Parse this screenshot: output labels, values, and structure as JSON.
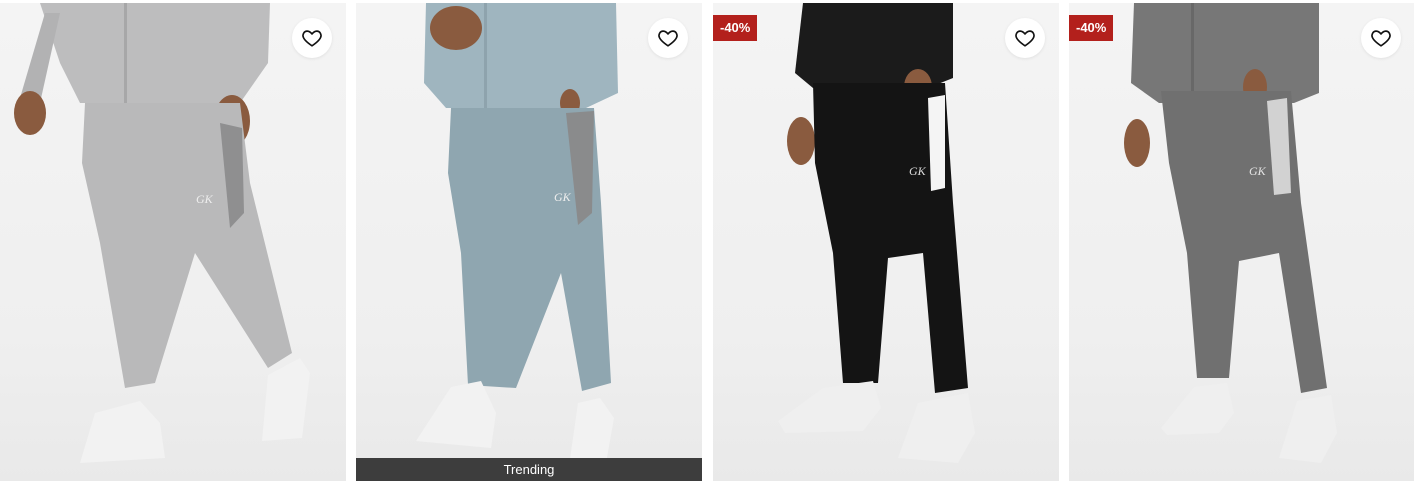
{
  "products": [
    {
      "id_label": "product-1",
      "wishlist_icon": "heart-outline-icon",
      "pant_color": "#b9b9ba",
      "panel_color": "#8f8f90",
      "top_color": "#bdbdbe",
      "logo": "GK"
    },
    {
      "id_label": "product-2",
      "wishlist_icon": "heart-outline-icon",
      "pant_color": "#8fa6b0",
      "panel_color": "#8a8b8c",
      "top_color": "#9fb5bf",
      "logo": "GK",
      "footer_tag": "Trending"
    },
    {
      "id_label": "product-3",
      "wishlist_icon": "heart-outline-icon",
      "pant_color": "#141414",
      "panel_color": "#f4f4f4",
      "top_color": "#1b1b1b",
      "logo": "GK",
      "badge": "-40%"
    },
    {
      "id_label": "product-4",
      "wishlist_icon": "heart-outline-icon",
      "pant_color": "#707070",
      "panel_color": "#d2d2d2",
      "top_color": "#777777",
      "logo": "GK",
      "badge": "-40%"
    }
  ],
  "colors": {
    "badge_bg": "#b3201c",
    "trend_bg": "#3d3d3d",
    "skin": "#8a5b3f",
    "shoe": "#f2f2f2"
  }
}
